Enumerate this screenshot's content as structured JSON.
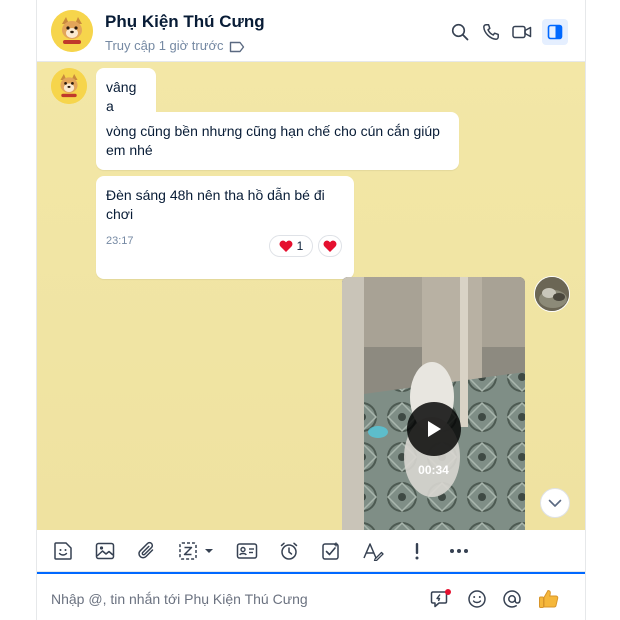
{
  "header": {
    "title": "Phụ Kiện Thú Cưng",
    "status": "Truy cập 1 giờ trước",
    "icons": [
      "search-icon",
      "phone-icon",
      "video-call-icon",
      "sidebar-toggle-icon"
    ]
  },
  "messages": [
    {
      "text": "vâng ạ"
    },
    {
      "text": "vòng cũng bền nhưng cũng hạn chế cho cún cắn giúp em nhé"
    },
    {
      "text": "Đèn sáng 48h nên tha hồ dẫn bé đi chơi",
      "time": "23:17",
      "reaction_count": "1"
    }
  ],
  "video": {
    "duration": "00:34"
  },
  "toolbar": {
    "icons": [
      "sticker-icon",
      "image-icon",
      "attachment-icon",
      "screenshot-icon",
      "contact-card-icon",
      "reminder-icon",
      "task-icon",
      "text-format-icon",
      "important-icon",
      "more-icon"
    ]
  },
  "composer": {
    "placeholder": "Nhập @, tin nhắn tới Phụ Kiện Thú Cưng"
  },
  "colors": {
    "accent": "#0068ff",
    "chat_bg": "#f2e6a4",
    "reaction": "#e5102f"
  }
}
